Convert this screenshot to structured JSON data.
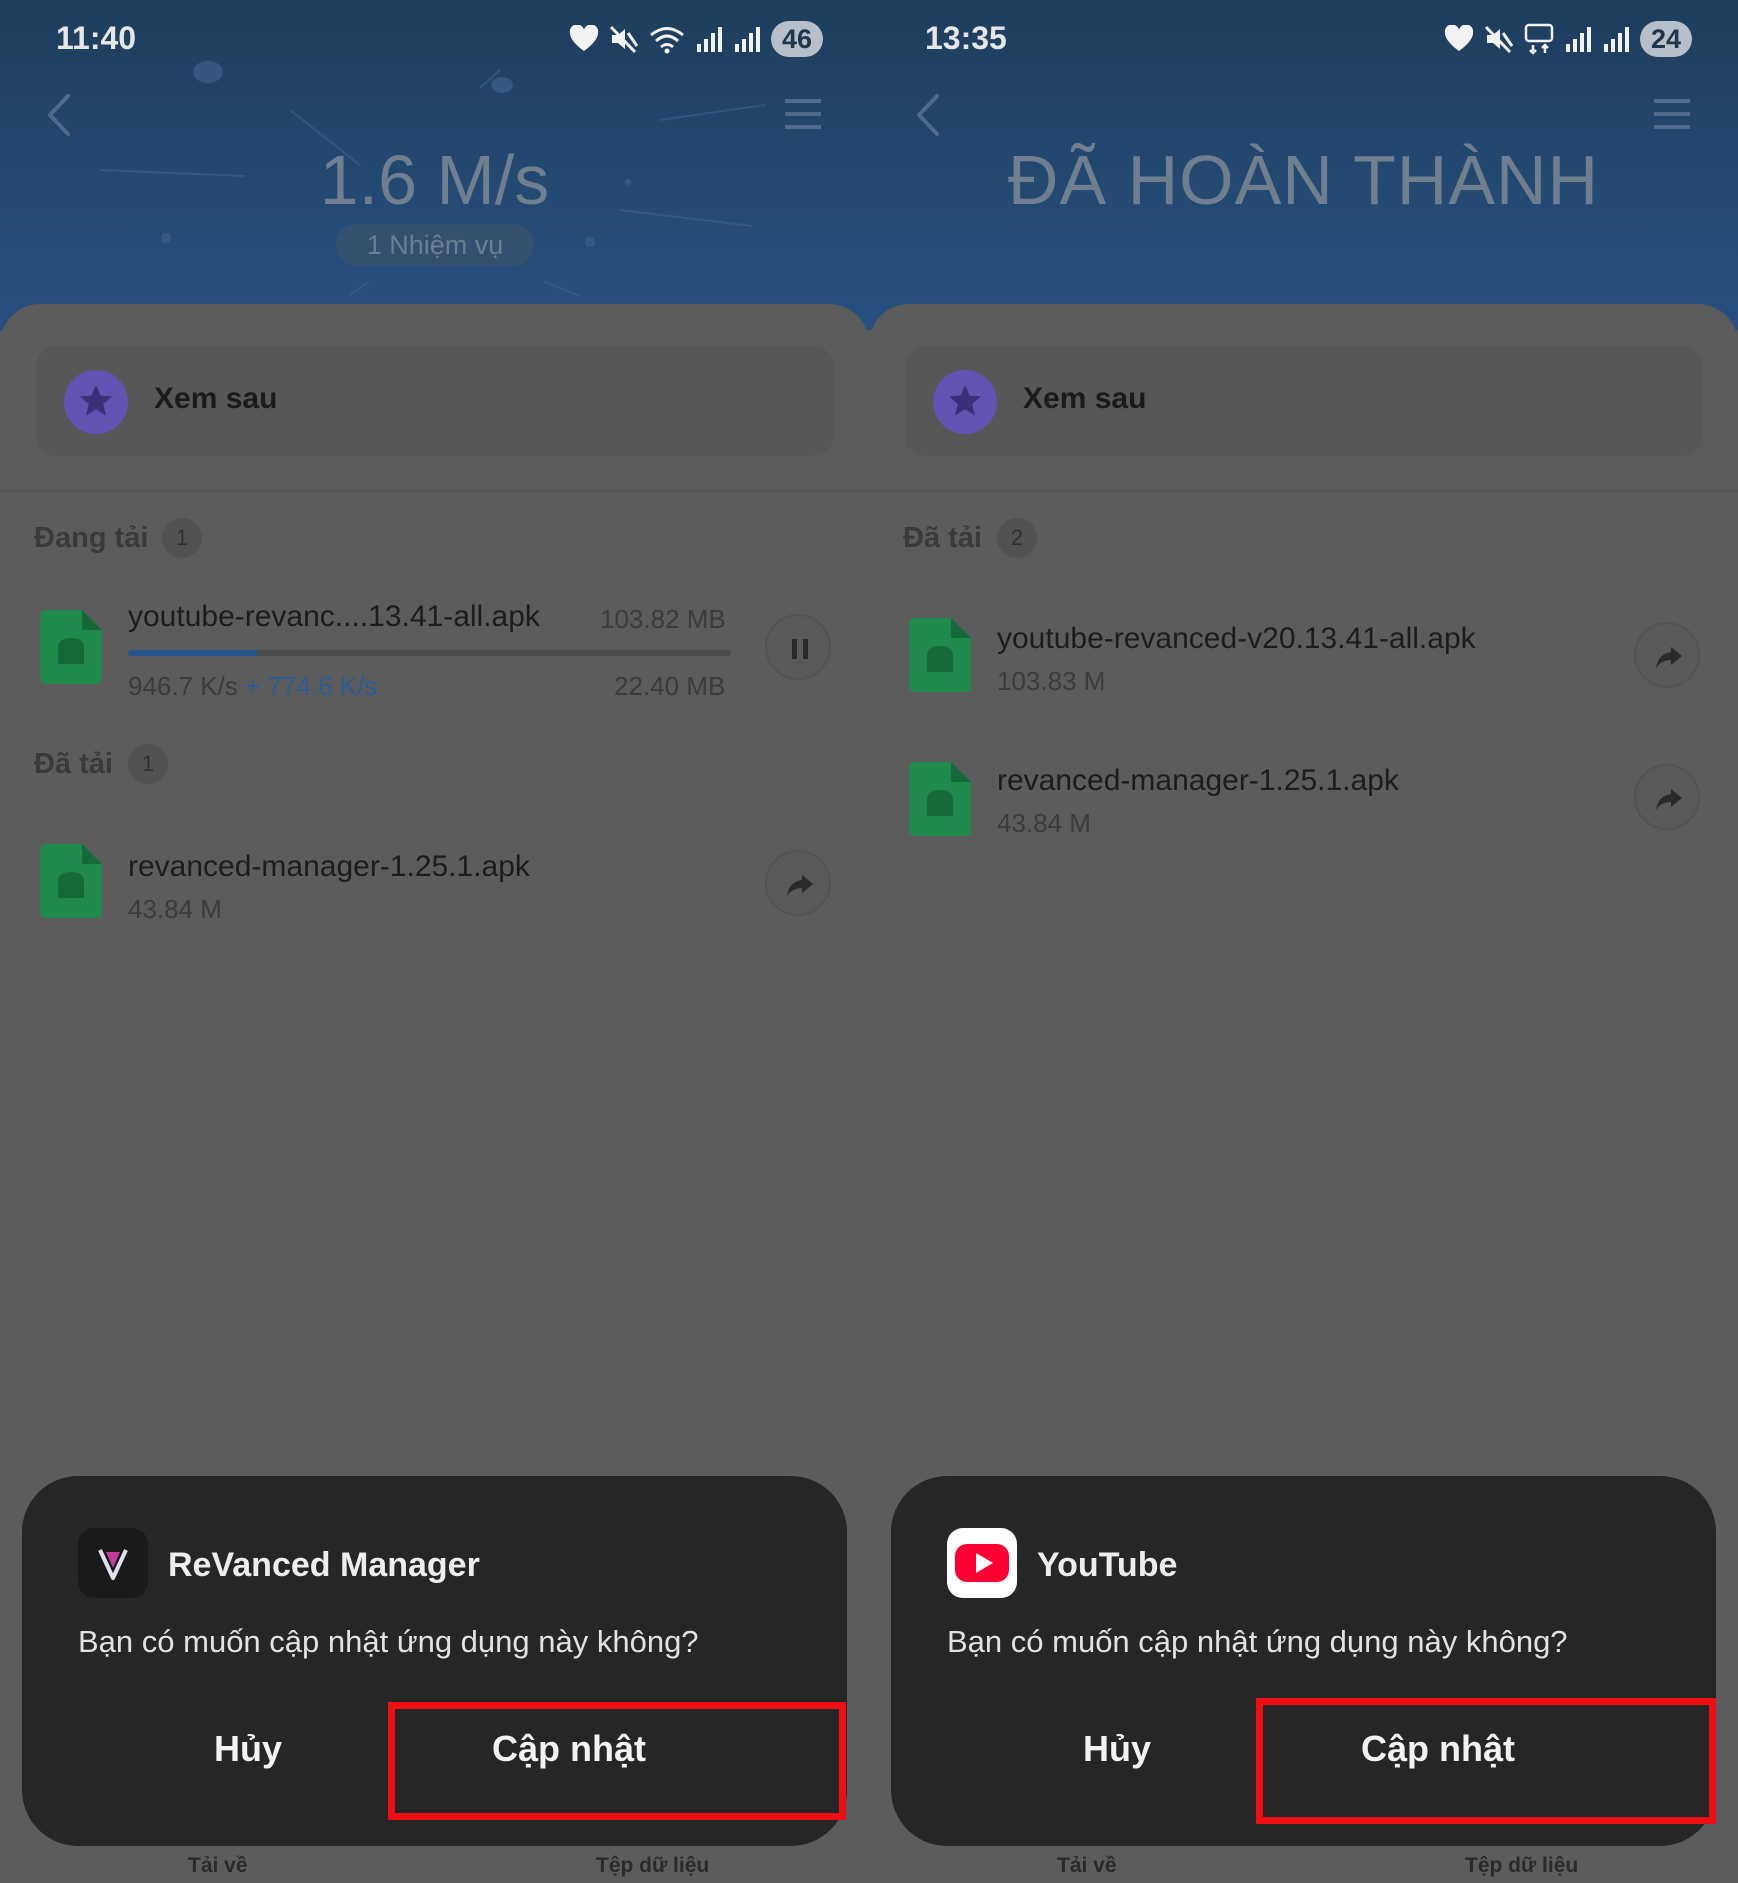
{
  "left": {
    "status_time": "11:40",
    "battery": "46",
    "header_value": "1.6 M/s",
    "task_pill": "1 Nhiệm vụ",
    "favorites_label": "Xem sau",
    "downloading": {
      "title": "Đang tải",
      "count": "1",
      "item": {
        "name": "youtube-revanc....13.41-all.apk",
        "total_size": "103.82 MB",
        "speed": "946.7 K/s",
        "speed_extra": "+ 774.6 K/s",
        "downloaded": "22.40 MB",
        "progress_fraction": 0.216
      }
    },
    "downloaded": {
      "title": "Đã tải",
      "count": "1",
      "items": [
        {
          "name": "revanced-manager-1.25.1.apk",
          "size": "43.84 M"
        }
      ]
    },
    "dialog": {
      "app_name": "ReVanced Manager",
      "message": "Bạn có muốn cập nhật ứng dụng này không?",
      "cancel_label": "Hủy",
      "update_label": "Cập nhật"
    },
    "nav": {
      "downloads": "Tải về",
      "files": "Tệp dữ liệu"
    }
  },
  "right": {
    "status_time": "13:35",
    "battery": "24",
    "header_title": "ĐÃ HOÀN THÀNH",
    "favorites_label": "Xem sau",
    "downloaded": {
      "title": "Đã tải",
      "count": "2",
      "items": [
        {
          "name": "youtube-revanced-v20.13.41-all.apk",
          "size": "103.83 M"
        },
        {
          "name": "revanced-manager-1.25.1.apk",
          "size": "43.84 M"
        }
      ]
    },
    "dialog": {
      "app_name": "YouTube",
      "message": "Bạn có muốn cập nhật ứng dụng này không?",
      "cancel_label": "Hủy",
      "update_label": "Cập nhật"
    },
    "nav": {
      "downloads": "Tải về",
      "files": "Tệp dữ liệu"
    }
  },
  "icons": {
    "heart": "heart-icon",
    "mute": "mute-icon",
    "wifi": "wifi-icon",
    "signal": "signal-icon",
    "network_5g": "5g-icon",
    "back": "back-icon",
    "menu": "menu-icon",
    "star": "star-icon",
    "apk_file": "android-file-icon",
    "pause": "pause-icon",
    "share": "share-icon"
  },
  "colors": {
    "header": "#244a73",
    "progress": "#27558e",
    "highlight": "#ee0f12",
    "dialog": "#262626",
    "apk_icon": "#1f8a4c",
    "star_circle": "#6353b3"
  }
}
